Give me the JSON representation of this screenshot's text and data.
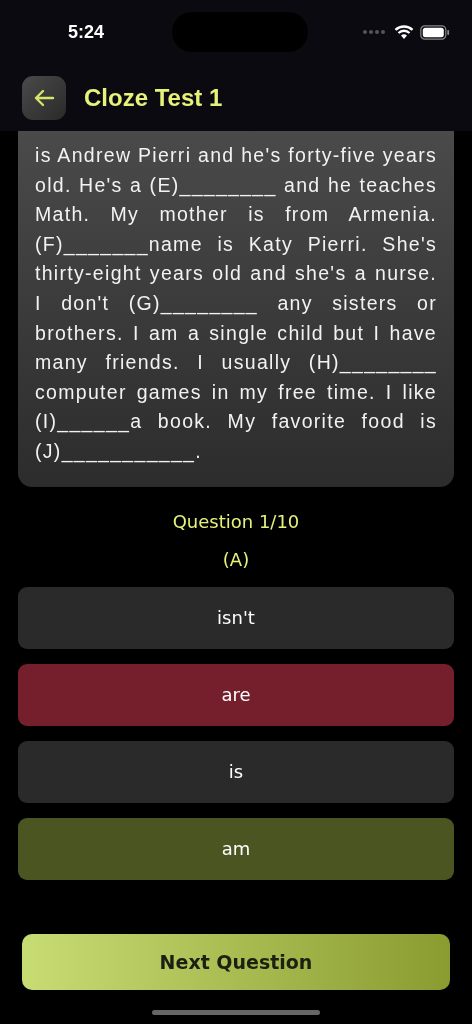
{
  "status_bar": {
    "time": "5:24"
  },
  "header": {
    "title": "Cloze Test 1"
  },
  "passage": "is Andrew Pierri and he's forty-five years old. He's a (E)________ and he teaches Math. My mother is from Armenia. (F)_______name is Katy Pierri. She's thirty-eight years old and she's a nurse. I don't (G)________ any sisters or brothers. I am a single child but I have many friends. I usually (H)________ computer games in my free time. I like (I)______a book. My favorite food is (J)___________.",
  "question": {
    "counter": "Question 1/10",
    "blank": "(A)"
  },
  "options": [
    {
      "label": "isn't",
      "wrong": false,
      "correct": false
    },
    {
      "label": "are",
      "wrong": true,
      "correct": false
    },
    {
      "label": "is",
      "wrong": false,
      "correct": false
    },
    {
      "label": "am",
      "wrong": false,
      "correct": true
    }
  ],
  "next_button": {
    "label": "Next Question"
  }
}
